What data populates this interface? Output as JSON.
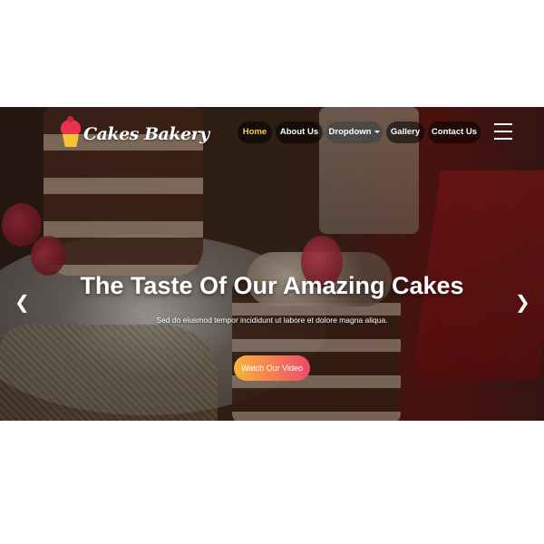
{
  "brand": {
    "name": "Cakes Bakery",
    "icon": "cupcake-icon"
  },
  "nav": {
    "items": [
      {
        "label": "Home",
        "active": true
      },
      {
        "label": "About Us",
        "active": false
      },
      {
        "label": "Dropdown",
        "active": false,
        "has_caret": true
      },
      {
        "label": "Gallery",
        "active": false
      },
      {
        "label": "Contact Us",
        "active": false
      }
    ],
    "menu_icon": "hamburger-menu-icon"
  },
  "hero": {
    "title": "The Taste Of Our Amazing Cakes",
    "subtitle": "Sed do eiusmod tempor incididunt ut labore et dolore magna aliqua.",
    "cta_label": "Watch Our Video",
    "prev_icon": "chevron-left-icon",
    "next_icon": "chevron-right-icon",
    "prev_glyph": "❮",
    "next_glyph": "❯"
  },
  "colors": {
    "active_nav": "#ffc845",
    "cta_gradient_start": "#f8b43a",
    "cta_gradient_end": "#f04a6a"
  }
}
